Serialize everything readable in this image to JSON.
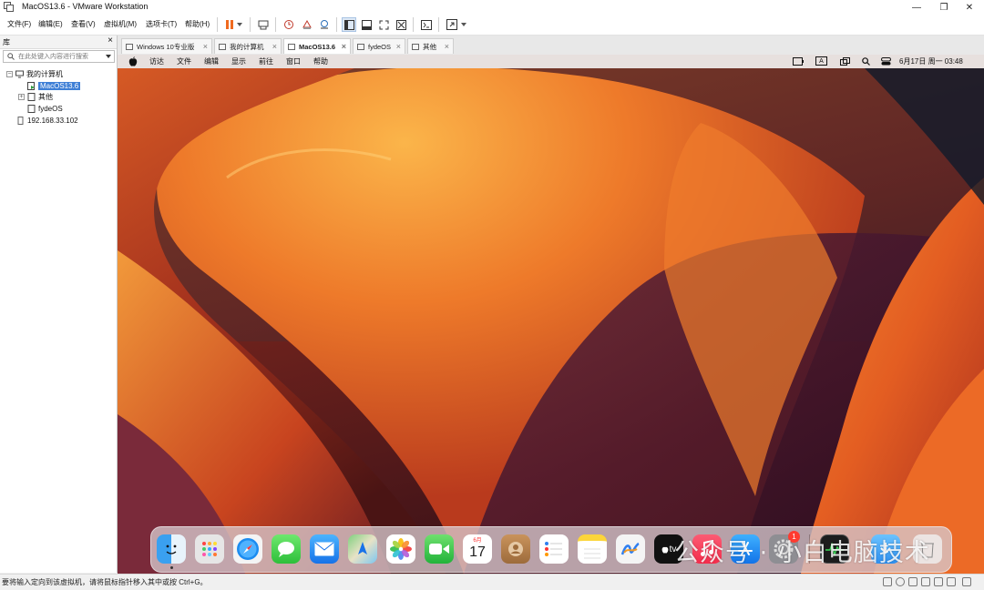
{
  "window": {
    "title": "MacOS13.6 - VMware Workstation",
    "minimize": "—",
    "maximize": "❐",
    "close": "✕"
  },
  "menu": [
    "文件(F)",
    "编辑(E)",
    "查看(V)",
    "虚拟机(M)",
    "选项卡(T)",
    "帮助(H)"
  ],
  "sidebar": {
    "title": "库",
    "close": "×",
    "search_placeholder": "在此处键入内容进行搜索",
    "tree": {
      "root": "我的计算机",
      "items": [
        "MacOS13.6",
        "其他",
        "fydeOS"
      ],
      "remote": "192.168.33.102"
    }
  },
  "tabs": [
    {
      "label": "Windows 10专业版",
      "active": false
    },
    {
      "label": "我的计算机",
      "active": false
    },
    {
      "label": "MacOS13.6",
      "active": true
    },
    {
      "label": "fydeOS",
      "active": false
    },
    {
      "label": "其他",
      "active": false
    }
  ],
  "mac_menubar": {
    "apple": "",
    "items": [
      "访达",
      "文件",
      "编辑",
      "显示",
      "前往",
      "窗口",
      "帮助"
    ],
    "input_indicator": "A",
    "clock": "6月17日 周一  03:48"
  },
  "dock": {
    "calendar_month": "6月",
    "calendar_day": "17",
    "tv_label": "tv",
    "badge": "1"
  },
  "watermark": "公众号 · 小白电脑技术",
  "status": "要将输入定向到该虚拟机，请将鼠标指针移入其中或按 Ctrl+G。",
  "colors": {
    "selection": "#3e7fd6",
    "badge": "#ff3b30",
    "pause": "#f06a1f"
  }
}
